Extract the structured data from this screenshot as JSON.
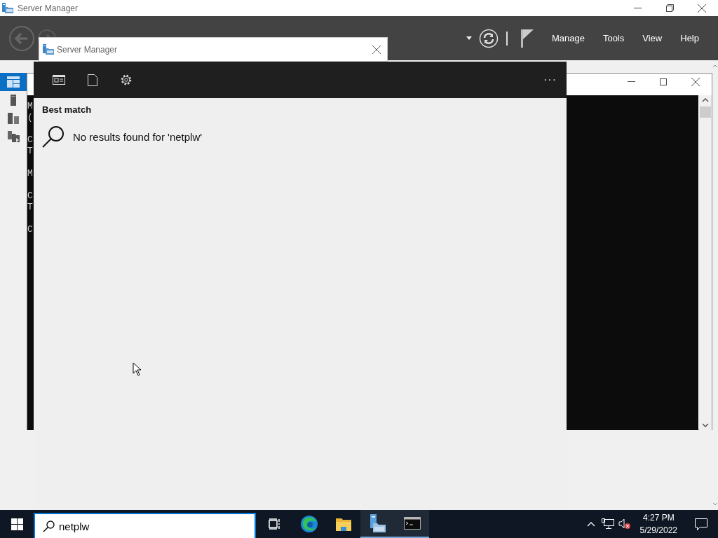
{
  "main_window": {
    "title": "Server Manager",
    "menu": [
      "Manage",
      "Tools",
      "View",
      "Help"
    ],
    "sidebar": [
      {
        "kind": "dashboard",
        "selected": true
      },
      {
        "kind": "server",
        "selected": false
      },
      {
        "kind": "servers",
        "selected": false
      },
      {
        "kind": "files",
        "selected": false
      }
    ]
  },
  "console": {
    "paragraphs": [
      [
        "M",
        "("
      ],
      [
        "C",
        "T"
      ],
      [
        "M"
      ],
      [
        "C",
        "T"
      ],
      [
        "C"
      ]
    ]
  },
  "popup": {
    "title": "Server Manager"
  },
  "search_panel": {
    "more": "···",
    "section": "Best match",
    "message": "No results found for 'netplw'"
  },
  "taskbar": {
    "search_value": "netplw",
    "apps": [
      {
        "kind": "task-view",
        "running": false
      },
      {
        "kind": "edge",
        "running": false
      },
      {
        "kind": "explorer",
        "running": false
      },
      {
        "kind": "server-manager",
        "running": true
      },
      {
        "kind": "terminal",
        "running": true
      }
    ],
    "time": "4:27 PM",
    "date": "5/29/2022"
  }
}
